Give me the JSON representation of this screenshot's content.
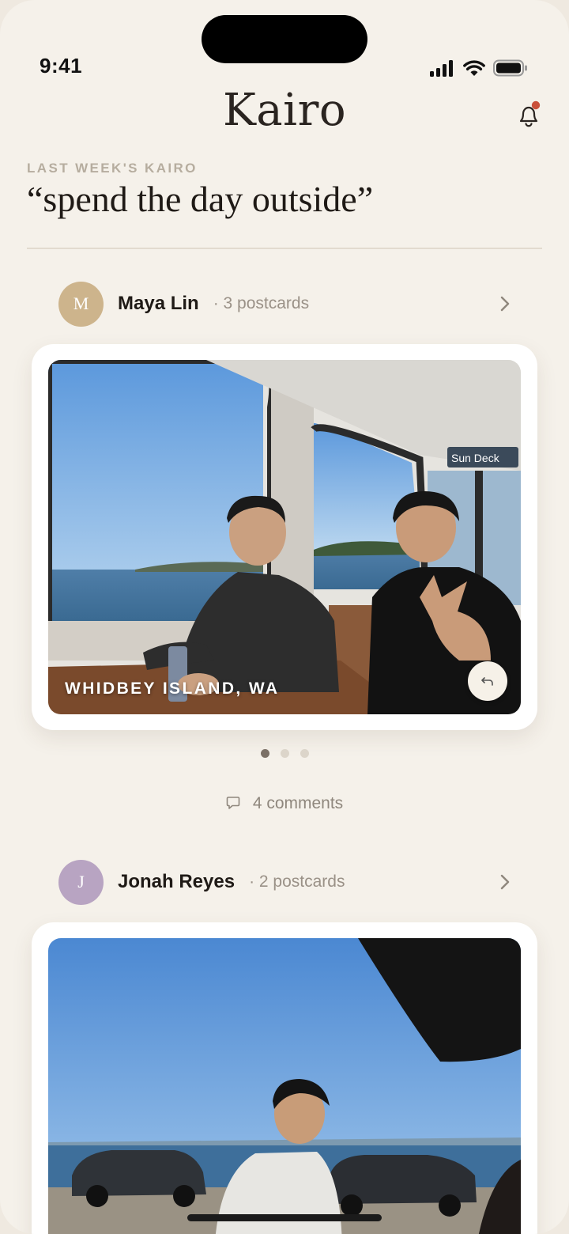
{
  "status_bar": {
    "time": "9:41"
  },
  "header": {
    "title": "Kairo",
    "notification_badge_color": "#c9503a"
  },
  "prompt_section": {
    "label": "LAST WEEK'S KAIRO",
    "prompt": "“spend the day outside”"
  },
  "posts": [
    {
      "avatar_initial": "M",
      "avatar_color": "#cdb48c",
      "author": "Maya Lin",
      "count": "· 3 postcards",
      "location": "WHIDBEY ISLAND, WA",
      "pagination": {
        "total": 3,
        "current": 1
      },
      "comments": "4 comments"
    },
    {
      "avatar_initial": "J",
      "avatar_color": "#b8a4c2",
      "author": "Jonah Reyes",
      "count": "· 2 postcards"
    }
  ],
  "icons": {
    "bell": "bell-icon",
    "chevron": "chevron-right-icon",
    "flip": "undo-flip-icon",
    "comment": "comment-bubble-icon"
  }
}
